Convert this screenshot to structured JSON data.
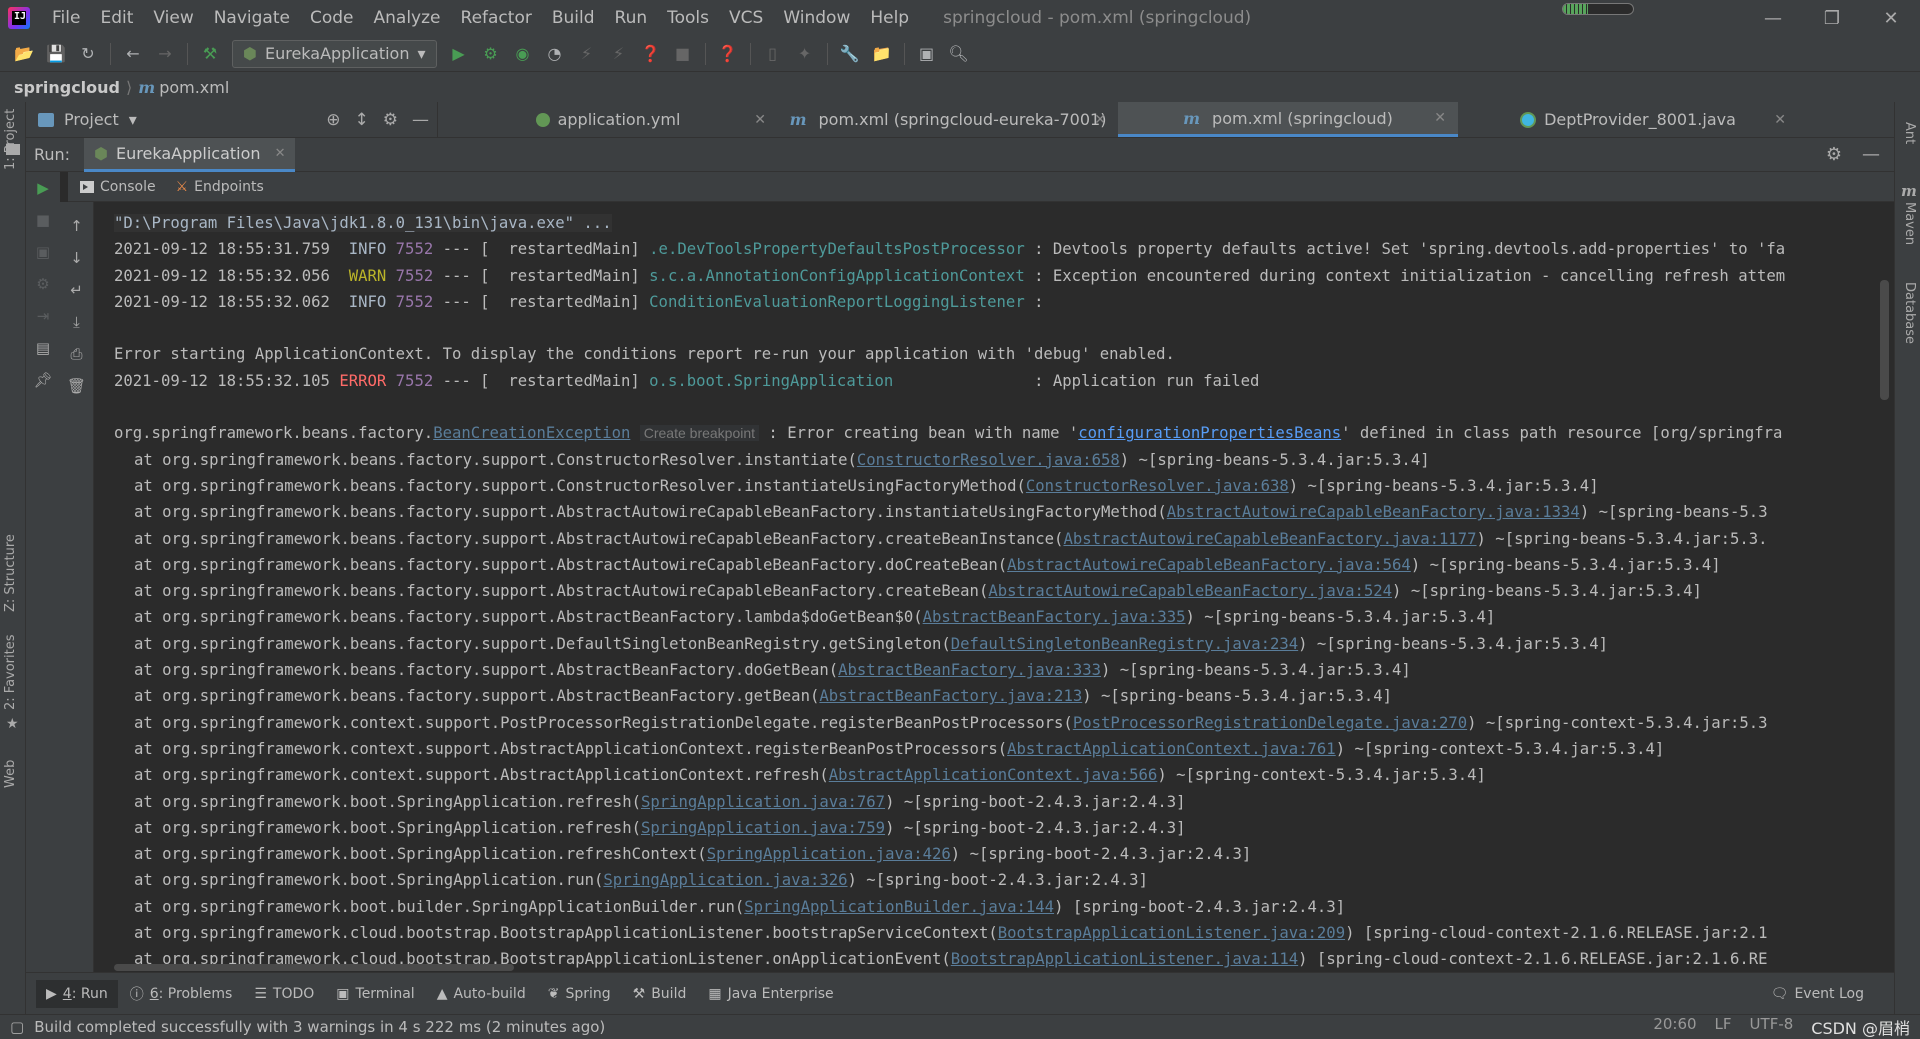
{
  "menubar": {
    "items": [
      "File",
      "Edit",
      "View",
      "Navigate",
      "Code",
      "Analyze",
      "Refactor",
      "Build",
      "Run",
      "Tools",
      "VCS",
      "Window",
      "Help"
    ],
    "window_title": "springcloud - pom.xml (springcloud)",
    "memory_used_fraction": 0.35
  },
  "toolbar": {
    "run_config": "EurekaApplication"
  },
  "breadcrumb": {
    "project": "springcloud",
    "file": "pom.xml"
  },
  "left_stripe": {
    "project_label": "1: Project",
    "structure_label": "Z: Structure",
    "favorites_label": "2: Favorites",
    "web_label": "Web"
  },
  "right_stripe": {
    "ant_label": "Ant",
    "maven_label": "Maven",
    "database_label": "Database"
  },
  "project_tool": {
    "label": "Project"
  },
  "editor_tabs": [
    {
      "label": "application.yml",
      "icon": "yaml-icon",
      "active": false
    },
    {
      "label": "pom.xml (springcloud-eureka-7001)",
      "icon": "maven-icon",
      "active": false
    },
    {
      "label": "pom.xml (springcloud)",
      "icon": "maven-icon",
      "active": true
    },
    {
      "label": "DeptProvider_8001.java",
      "icon": "java-class-icon",
      "active": false
    }
  ],
  "run_panel": {
    "label": "Run:",
    "tab": "EurekaApplication",
    "subtabs": [
      "Console",
      "Endpoints"
    ]
  },
  "console": {
    "command": "\"D:\\Program Files\\Java\\jdk1.8.0_131\\bin\\java.exe\" ...",
    "logs": [
      {
        "ts": "2021-09-12 18:55:31.759",
        "level": " INFO",
        "pid": "7552",
        "thread": " --- [  restartedMain] ",
        "logger": ".e.DevToolsPropertyDefaultsPostProcessor",
        "msg": " : Devtools property defaults active! Set 'spring.devtools.add-properties' to 'fa"
      },
      {
        "ts": "2021-09-12 18:55:32.056",
        "level": " WARN",
        "pid": "7552",
        "thread": " --- [  restartedMain] ",
        "logger": "s.c.a.AnnotationConfigApplicationContext",
        "msg": " : Exception encountered during context initialization - cancelling refresh attem"
      },
      {
        "ts": "2021-09-12 18:55:32.062",
        "level": " INFO",
        "pid": "7552",
        "thread": " --- [  restartedMain] ",
        "logger": "ConditionEvaluationReportLoggingListener",
        "msg": " :"
      }
    ],
    "error_banner": "Error starting ApplicationContext. To display the conditions report re-run your application with 'debug' enabled.",
    "error_log": {
      "ts": "2021-09-12 18:55:32.105",
      "level": "ERROR",
      "pid": "7552",
      "thread": " --- [  restartedMain] ",
      "logger": "o.s.boot.SpringApplication",
      "msg": "               : Application run failed"
    },
    "exception": {
      "prefix": "org.springframework.beans.factory.",
      "class_link": "BeanCreationException",
      "breakpoint_hint": "Create breakpoint",
      "msg_before": " : Error creating bean with name '",
      "bean_link": "configurationPropertiesBeans",
      "msg_after": "' defined in class path resource [org/springfra"
    },
    "stack": [
      {
        "method": "at org.springframework.beans.factory.support.ConstructorResolver.instantiate(",
        "src": "ConstructorResolver.java:658",
        "tail": ") ~[spring-beans-5.3.4.jar:5.3.4]"
      },
      {
        "method": "at org.springframework.beans.factory.support.ConstructorResolver.instantiateUsingFactoryMethod(",
        "src": "ConstructorResolver.java:638",
        "tail": ") ~[spring-beans-5.3.4.jar:5.3.4]"
      },
      {
        "method": "at org.springframework.beans.factory.support.AbstractAutowireCapableBeanFactory.instantiateUsingFactoryMethod(",
        "src": "AbstractAutowireCapableBeanFactory.java:1334",
        "tail": ") ~[spring-beans-5.3"
      },
      {
        "method": "at org.springframework.beans.factory.support.AbstractAutowireCapableBeanFactory.createBeanInstance(",
        "src": "AbstractAutowireCapableBeanFactory.java:1177",
        "tail": ") ~[spring-beans-5.3.4.jar:5.3."
      },
      {
        "method": "at org.springframework.beans.factory.support.AbstractAutowireCapableBeanFactory.doCreateBean(",
        "src": "AbstractAutowireCapableBeanFactory.java:564",
        "tail": ") ~[spring-beans-5.3.4.jar:5.3.4]"
      },
      {
        "method": "at org.springframework.beans.factory.support.AbstractAutowireCapableBeanFactory.createBean(",
        "src": "AbstractAutowireCapableBeanFactory.java:524",
        "tail": ") ~[spring-beans-5.3.4.jar:5.3.4]"
      },
      {
        "method": "at org.springframework.beans.factory.support.AbstractBeanFactory.lambda$doGetBean$0(",
        "src": "AbstractBeanFactory.java:335",
        "tail": ") ~[spring-beans-5.3.4.jar:5.3.4]"
      },
      {
        "method": "at org.springframework.beans.factory.support.DefaultSingletonBeanRegistry.getSingleton(",
        "src": "DefaultSingletonBeanRegistry.java:234",
        "tail": ") ~[spring-beans-5.3.4.jar:5.3.4]"
      },
      {
        "method": "at org.springframework.beans.factory.support.AbstractBeanFactory.doGetBean(",
        "src": "AbstractBeanFactory.java:333",
        "tail": ") ~[spring-beans-5.3.4.jar:5.3.4]"
      },
      {
        "method": "at org.springframework.beans.factory.support.AbstractBeanFactory.getBean(",
        "src": "AbstractBeanFactory.java:213",
        "tail": ") ~[spring-beans-5.3.4.jar:5.3.4]"
      },
      {
        "method": "at org.springframework.context.support.PostProcessorRegistrationDelegate.registerBeanPostProcessors(",
        "src": "PostProcessorRegistrationDelegate.java:270",
        "tail": ") ~[spring-context-5.3.4.jar:5.3"
      },
      {
        "method": "at org.springframework.context.support.AbstractApplicationContext.registerBeanPostProcessors(",
        "src": "AbstractApplicationContext.java:761",
        "tail": ") ~[spring-context-5.3.4.jar:5.3.4]"
      },
      {
        "method": "at org.springframework.context.support.AbstractApplicationContext.refresh(",
        "src": "AbstractApplicationContext.java:566",
        "tail": ") ~[spring-context-5.3.4.jar:5.3.4]"
      },
      {
        "method": "at org.springframework.boot.SpringApplication.refresh(",
        "src": "SpringApplication.java:767",
        "tail": ") ~[spring-boot-2.4.3.jar:2.4.3]"
      },
      {
        "method": "at org.springframework.boot.SpringApplication.refresh(",
        "src": "SpringApplication.java:759",
        "tail": ") ~[spring-boot-2.4.3.jar:2.4.3]"
      },
      {
        "method": "at org.springframework.boot.SpringApplication.refreshContext(",
        "src": "SpringApplication.java:426",
        "tail": ") ~[spring-boot-2.4.3.jar:2.4.3]"
      },
      {
        "method": "at org.springframework.boot.SpringApplication.run(",
        "src": "SpringApplication.java:326",
        "tail": ") ~[spring-boot-2.4.3.jar:2.4.3]"
      },
      {
        "method": "at org.springframework.boot.builder.SpringApplicationBuilder.run(",
        "src": "SpringApplicationBuilder.java:144",
        "tail": ") [spring-boot-2.4.3.jar:2.4.3]"
      },
      {
        "method": "at org.springframework.cloud.bootstrap.BootstrapApplicationListener.bootstrapServiceContext(",
        "src": "BootstrapApplicationListener.java:209",
        "tail": ") [spring-cloud-context-2.1.6.RELEASE.jar:2.1"
      },
      {
        "method": "at org.springframework.cloud.bootstrap.BootstrapApplicationListener.onApplicationEvent(",
        "src": "BootstrapApplicationListener.java:114",
        "tail": ") [spring-cloud-context-2.1.6.RELEASE.jar:2.1.6.RE"
      }
    ]
  },
  "tool_windows": [
    {
      "num": "4",
      "label": ": Run",
      "icon": "play-icon",
      "active": true
    },
    {
      "num": "6",
      "label": ": Problems",
      "icon": "problems-icon",
      "active": false
    },
    {
      "num": "",
      "label": "TODO",
      "icon": "todo-icon",
      "active": false
    },
    {
      "num": "",
      "label": "Terminal",
      "icon": "terminal-icon",
      "active": false
    },
    {
      "num": "",
      "label": "Auto-build",
      "icon": "autobuild-icon",
      "active": false
    },
    {
      "num": "",
      "label": "Spring",
      "icon": "spring-icon",
      "active": false
    },
    {
      "num": "",
      "label": "Build",
      "icon": "build-icon",
      "active": false
    },
    {
      "num": "",
      "label": "Java Enterprise",
      "icon": "java-enterprise-icon",
      "active": false
    }
  ],
  "event_log": "Event Log",
  "status": {
    "message": "Build completed successfully with 3 warnings in 4 s 222 ms (2 minutes ago)",
    "position": "20:60",
    "line_sep": "LF",
    "encoding": "UTF-8",
    "watermark": "CSDN @眉梢"
  },
  "colors": {
    "background": "#2b2b2b",
    "panel": "#3c3f41",
    "logger": "#4e9a9a",
    "error": "#ff6b68",
    "warn": "#bbb529",
    "pid": "#9876aa",
    "link": "#589df6",
    "active_tab_underline": "#4a88c7"
  }
}
